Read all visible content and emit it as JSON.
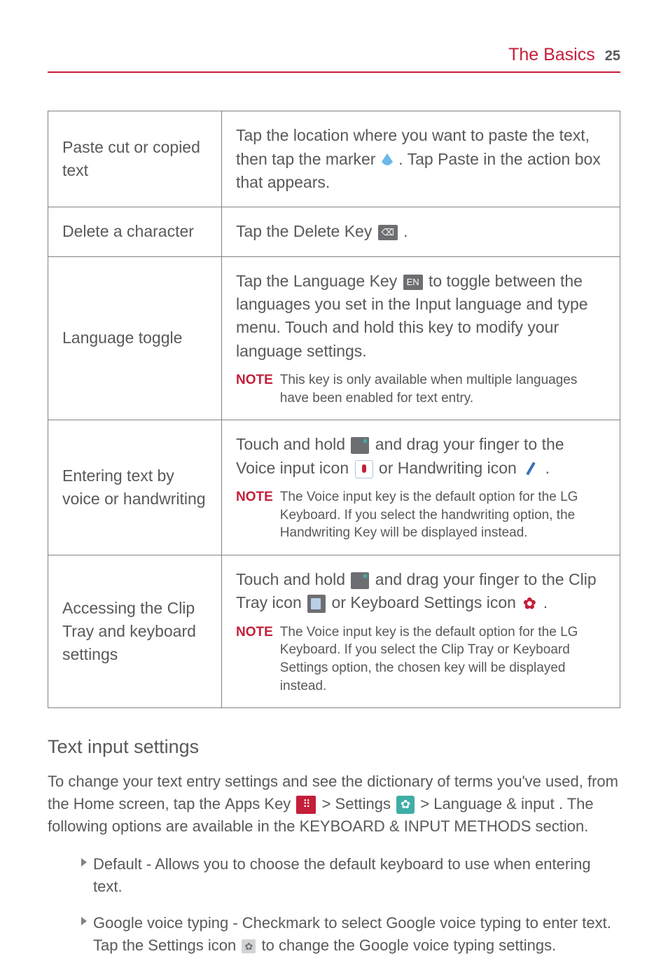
{
  "header": {
    "title": "The Basics",
    "page": "25"
  },
  "table": {
    "rows": [
      {
        "label": "Paste cut or copied text",
        "desc_parts": [
          "Tap the location where you want to paste the text, then tap the marker ",
          ". Tap ",
          "Paste",
          " in the action box that appears."
        ]
      },
      {
        "label": "Delete a character",
        "desc_parts": [
          "Tap the ",
          "Delete Key",
          " ",
          "."
        ]
      },
      {
        "label": "Language toggle",
        "desc_parts": [
          "Tap the ",
          "Language Key",
          " ",
          " to toggle between the languages you set in the Input language and type menu. Touch and hold this key to modify your language settings."
        ],
        "note_label": "NOTE",
        "note": "This key is only available when multiple languages have been enabled for text entry."
      },
      {
        "label": "Entering text by voice or handwriting",
        "desc_parts": [
          "Touch and hold ",
          " and drag your finger to the ",
          "Voice input",
          " icon ",
          " or ",
          "Handwriting",
          " icon ",
          "."
        ],
        "note_label": "NOTE",
        "note": "The Voice input key is the default option for the LG Keyboard. If you select the handwriting option, the Handwriting Key will be displayed instead."
      },
      {
        "label": "Accessing the Clip Tray and keyboard settings",
        "desc_parts": [
          "Touch and hold ",
          " and drag your finger to the ",
          "Clip Tray",
          " icon ",
          " or ",
          "Keyboard Settings",
          " icon ",
          "."
        ],
        "note_label": "NOTE",
        "note": "The Voice input key is the default option for the LG Keyboard. If you select the Clip Tray or Keyboard Settings option, the chosen key will be displayed instead."
      }
    ]
  },
  "section": {
    "heading": "Text input settings",
    "para_parts": [
      "To change your text entry settings and see the dictionary of terms you've used, from the Home screen, tap the ",
      "Apps Key",
      " ",
      " > ",
      "Settings",
      " ",
      " > ",
      "Language & input",
      ". The following options are available in the KEYBOARD & INPUT METHODS section."
    ],
    "bullets": [
      {
        "lead": "Default",
        "rest": " - Allows you to choose the default keyboard to use when entering text."
      },
      {
        "lead": "Google voice typing",
        "rest_parts": [
          " - Checkmark to select Google voice typing to enter text. Tap the Settings icon ",
          " to change the Google voice typing settings."
        ]
      }
    ]
  }
}
